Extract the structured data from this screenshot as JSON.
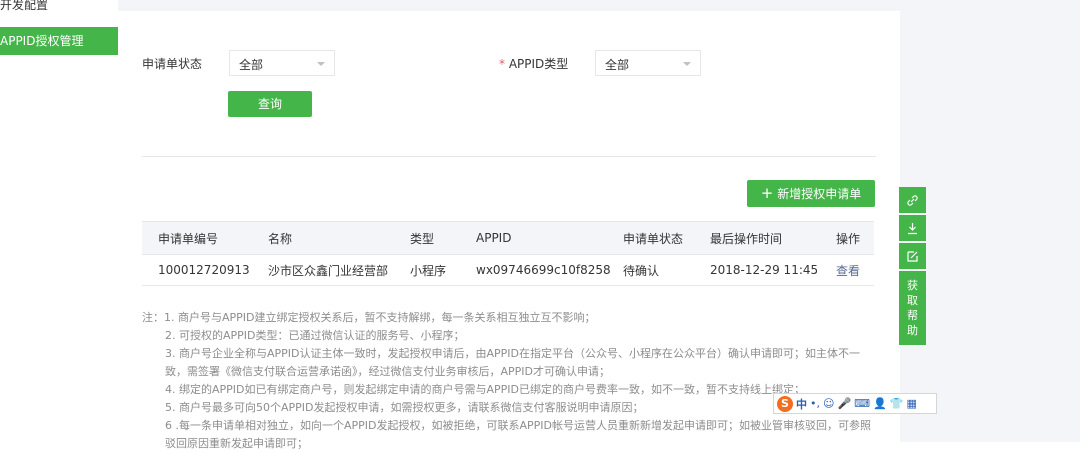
{
  "sidebar": {
    "items": [
      {
        "label": "开发配置"
      },
      {
        "label": "APPID授权管理"
      }
    ]
  },
  "filters": {
    "status_label": "申请单状态",
    "status_value": "全部",
    "type_required_mark": "*",
    "type_label": "APPID类型",
    "type_value": "全部",
    "query_button": "查询"
  },
  "actions": {
    "add_icon": "+",
    "add_label": "新增授权申请单"
  },
  "table": {
    "headers": [
      "申请单编号",
      "名称",
      "类型",
      "APPID",
      "申请单状态",
      "最后操作时间",
      "操作"
    ],
    "rows": [
      [
        "100012720913",
        "沙市区众鑫门业经营部",
        "小程序",
        "wx09746699c10f8258",
        "待确认",
        "2018-12-29 11:45",
        "查看"
      ]
    ]
  },
  "notes": {
    "prefix": "注：",
    "lines": [
      "1. 商户号与APPID建立绑定授权关系后，暂不支持解绑，每一条关系相互独立互不影响；",
      "2. 可授权的APPID类型：已通过微信认证的服务号、小程序；",
      "3. 商户号企业全称与APPID认证主体一致时，发起授权申请后，由APPID在指定平台（公众号、小程序在公众平台）确认申请即可；如主体不一",
      "致，需签署《微信支付联合运营承诺函》，经过微信支付业务审核后，APPID才可确认申请；",
      "4. 绑定的APPID如已有绑定商户号，则发起绑定申请的商户号需与APPID已绑定的商户号费率一致，如不一致，暂不支持线上绑定；",
      "5. 商户号最多可向50个APPID发起授权申请，如需授权更多，请联系微信支付客服说明申请原因；",
      "6 .每一条申请单相对独立，如向一个APPID发起授权，如被拒绝，可联系APPID帐号运营人员重新新增发起申请即可；如被业管审核驳回，可参照",
      "驳回原因重新发起申请即可；"
    ]
  },
  "float_toolbar": {
    "icons": [
      "link-icon",
      "download-icon",
      "edit-icon"
    ],
    "help_chars": [
      "获",
      "取",
      "帮",
      "助"
    ]
  },
  "ime_bar": {
    "logo": "S",
    "mode": "中",
    "glyphs": [
      "•,",
      "☺",
      "🎤",
      "⌨",
      "👤",
      "👕",
      "▦"
    ]
  },
  "colors": {
    "brand_green": "#44b549",
    "link_blue": "#576b95",
    "required_red": "#e15f63"
  }
}
